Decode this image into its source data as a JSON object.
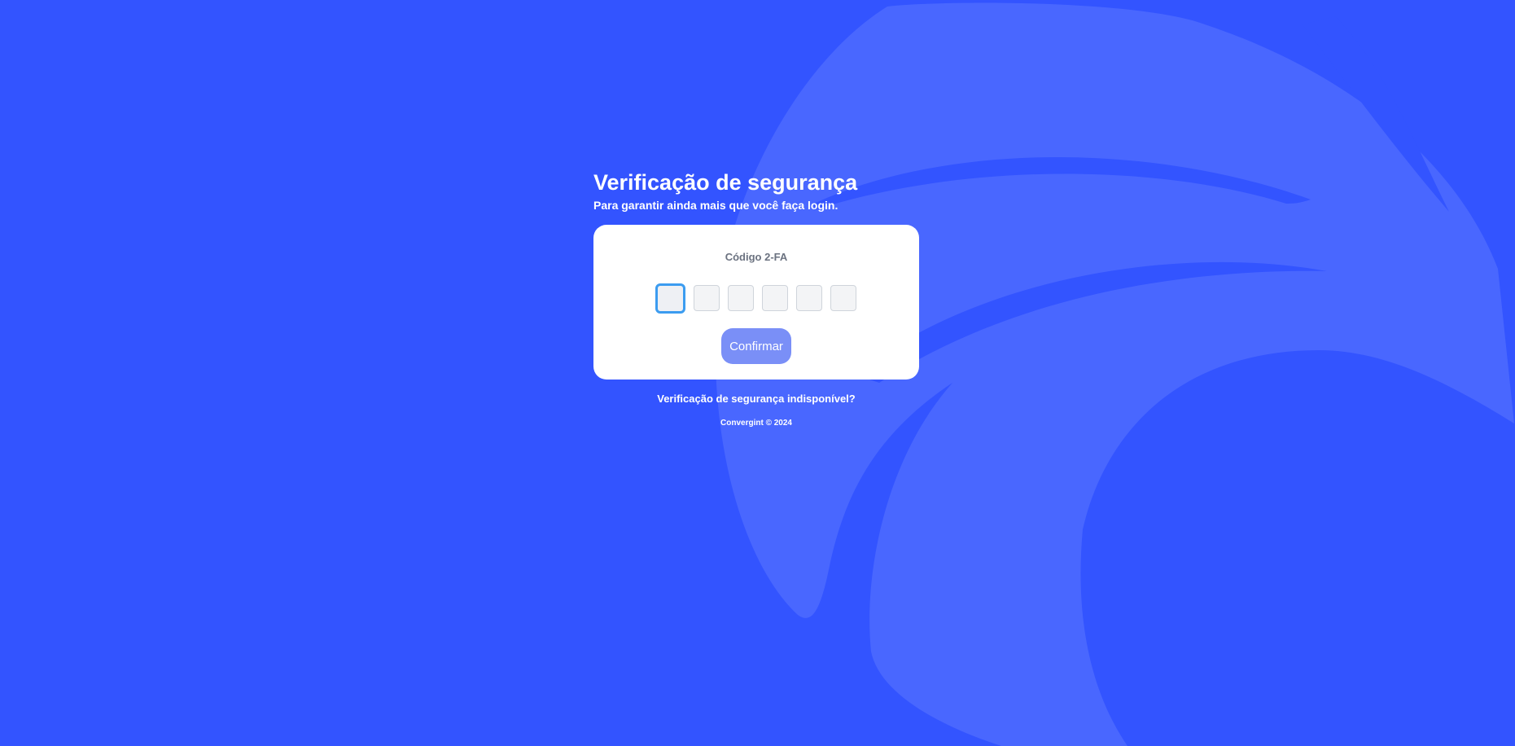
{
  "colors": {
    "background": "#3354ff",
    "background_shape": "#4967ff",
    "card": "#ffffff",
    "button": "#7a8ff7",
    "focus_border": "#3b9cf0"
  },
  "page": {
    "title": "Verificação de segurança",
    "subtitle": "Para garantir ainda mais que você faça login."
  },
  "card": {
    "label": "Código 2-FA",
    "otp_digits": [
      "",
      "",
      "",
      "",
      "",
      ""
    ],
    "confirm_label": "Confirmar"
  },
  "links": {
    "unavailable": "Verificação de segurança indisponível?"
  },
  "footer": {
    "copyright": "Convergint © 2024"
  }
}
